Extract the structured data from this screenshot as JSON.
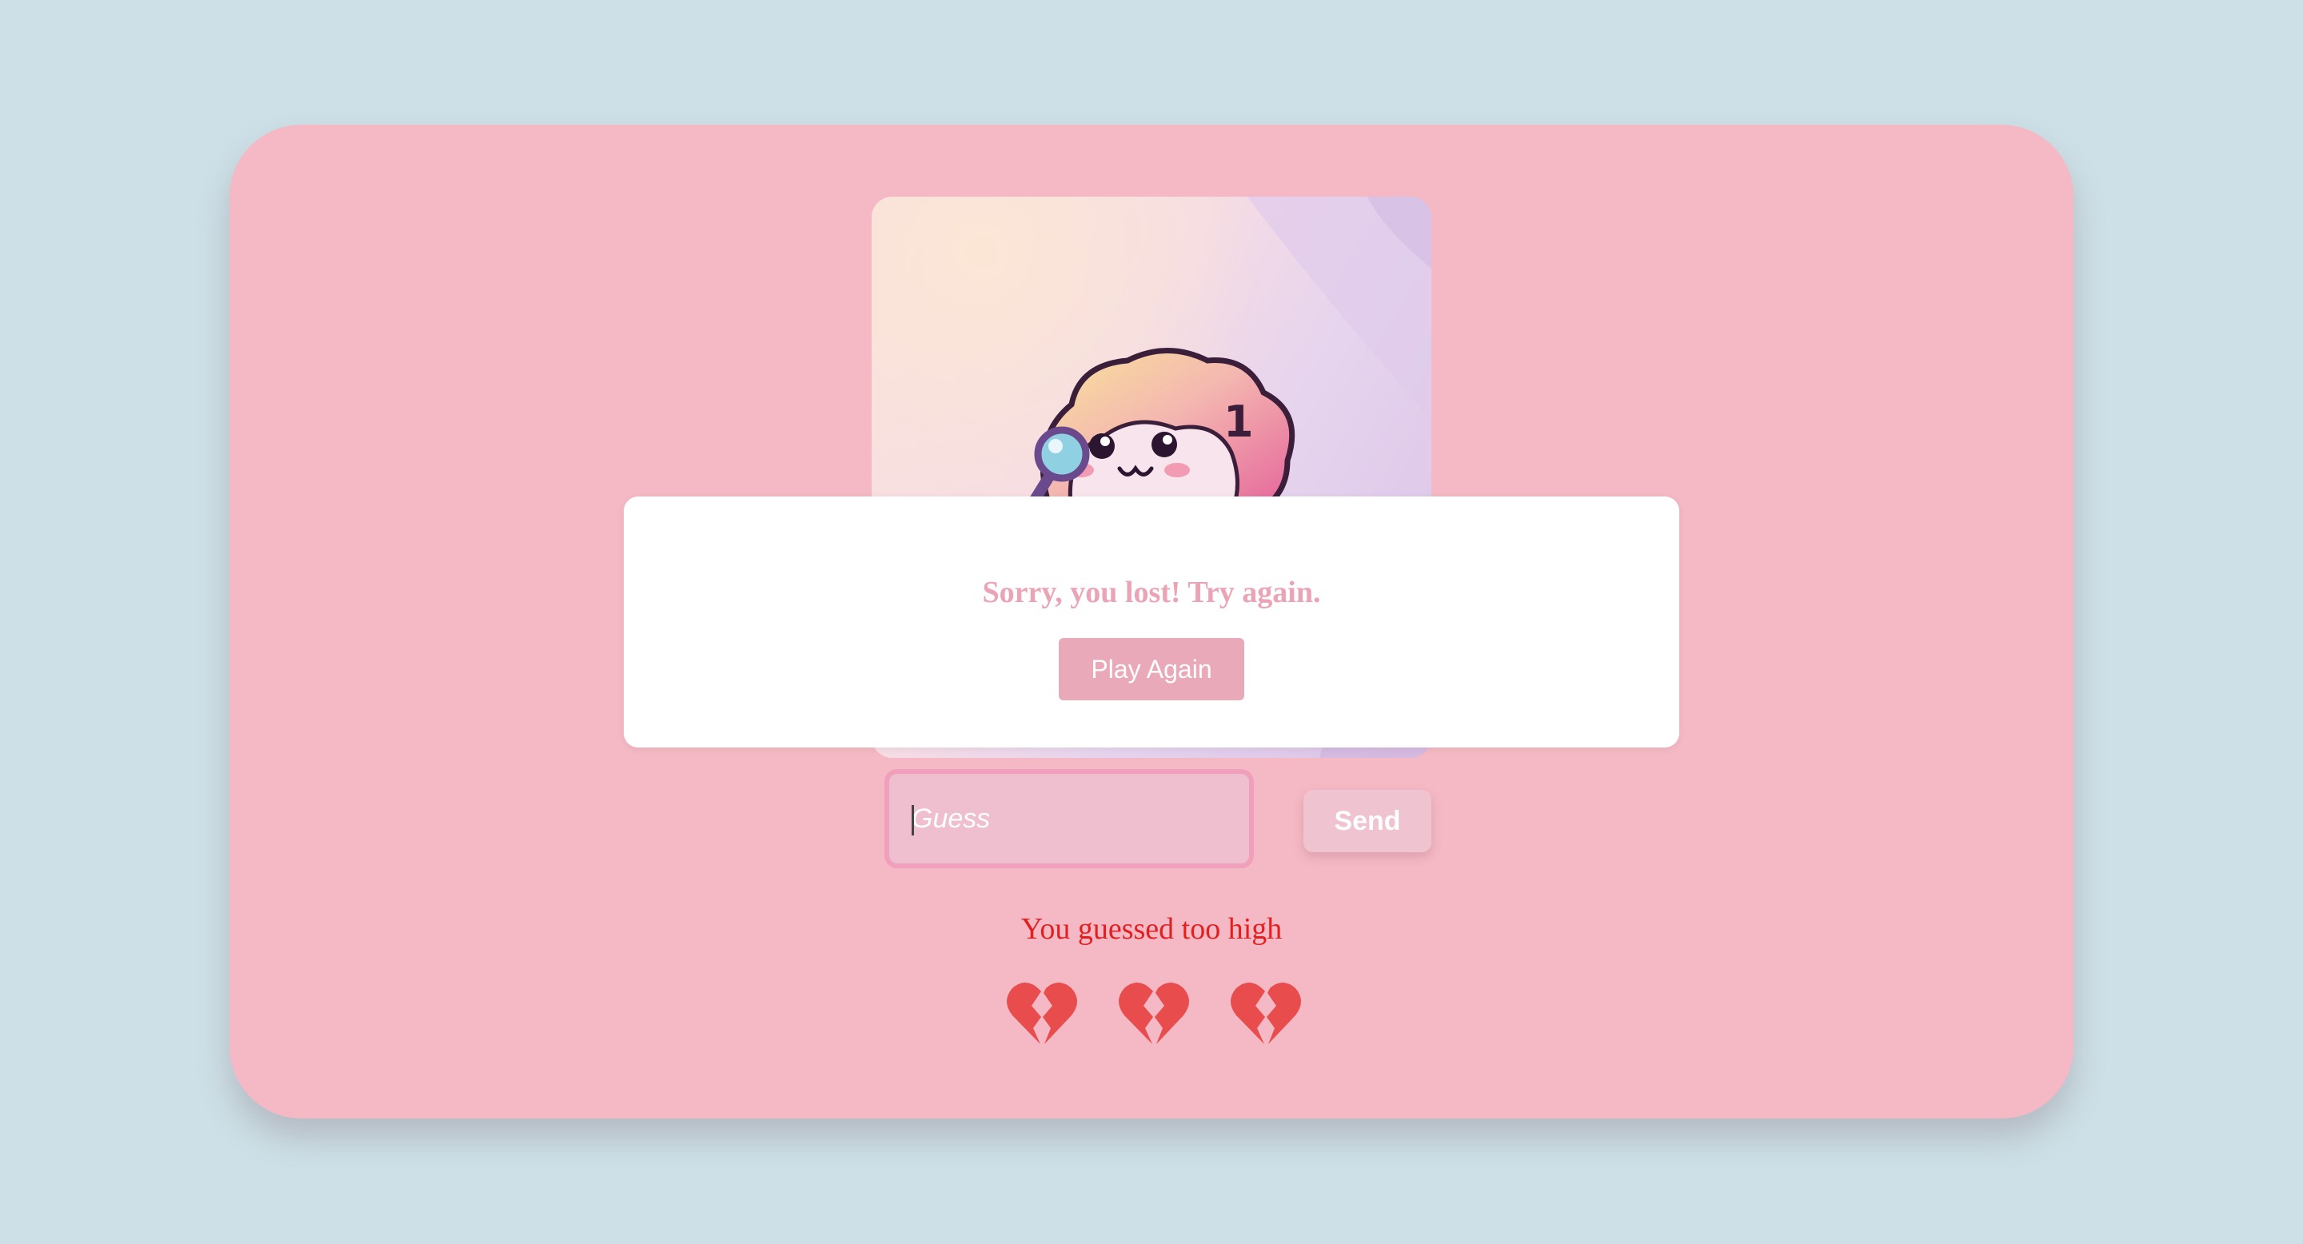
{
  "game": {
    "input_placeholder": "Guess",
    "send_label": "Send",
    "feedback_text": "You guessed too high",
    "lives_remaining": 0,
    "lives_total": 3,
    "hearts": [
      "broken-heart-icon",
      "broken-heart-icon",
      "broken-heart-icon"
    ]
  },
  "modal": {
    "message": "Sorry, you lost! Try again.",
    "play_again_label": "Play Again"
  },
  "colors": {
    "page_background": "#cde0e7",
    "card_background": "#f4b9c4",
    "accent_pink": "#e9a9b8",
    "feedback_red": "#e32020",
    "heart_red": "#e84c4c"
  },
  "mascot": {
    "badge_text": "1"
  }
}
